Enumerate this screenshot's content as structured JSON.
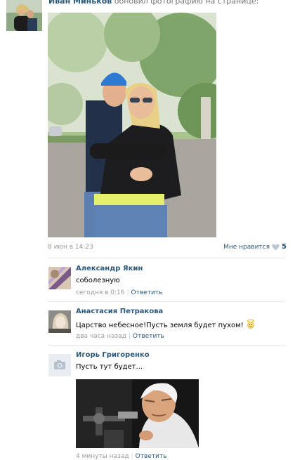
{
  "post": {
    "author_name": "Иван Миньков",
    "action_text": " обновил фотографию на странице:",
    "date": "8 июн в 14:23",
    "like_label": "Мне нравится",
    "like_count": "5"
  },
  "comments": [
    {
      "author": "Александр Якин",
      "text": "соболезную",
      "time": "сегодня в 0:16",
      "reply_label": "Ответить"
    },
    {
      "author": "Анастасия Петракова",
      "text": "Царство небесное!Пусть земля будет пухом!",
      "emoji": "angel",
      "time": "два часа назад",
      "reply_label": "Ответить"
    },
    {
      "author": "Игорь Григоренко",
      "text": "Пусть тут будет...",
      "time": "4 минуты назад",
      "reply_label": "Ответить",
      "avatar_icon": "camera-icon"
    }
  ],
  "colors": {
    "link": "#2b587a",
    "muted": "#999999",
    "separator": "#e4e8ed"
  }
}
